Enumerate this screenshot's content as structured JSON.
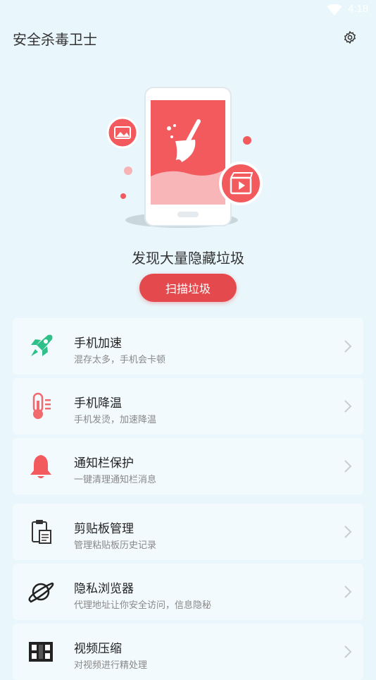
{
  "status_bar": {
    "time": "4:18"
  },
  "header": {
    "title": "安全杀毒卫士"
  },
  "hero": {
    "headline": "发现大量隐藏垃圾",
    "scan_button": "扫描垃圾"
  },
  "features": [
    {
      "title": "手机加速",
      "subtitle": "混存太多，手机会卡顿"
    },
    {
      "title": "手机降温",
      "subtitle": "手机发烫，加速降温"
    },
    {
      "title": "通知栏保护",
      "subtitle": "一键清理通知栏消息"
    },
    {
      "title": "剪贴板管理",
      "subtitle": "管理粘贴板历史记录"
    },
    {
      "title": "隐私浏览器",
      "subtitle": "代理地址让你安全访问，信息隐秘"
    },
    {
      "title": "视频压缩",
      "subtitle": "对视频进行精处理"
    }
  ],
  "colors": {
    "accent": "#e4494d",
    "background": "#e9f6fb",
    "rocket": "#2fc08a"
  }
}
